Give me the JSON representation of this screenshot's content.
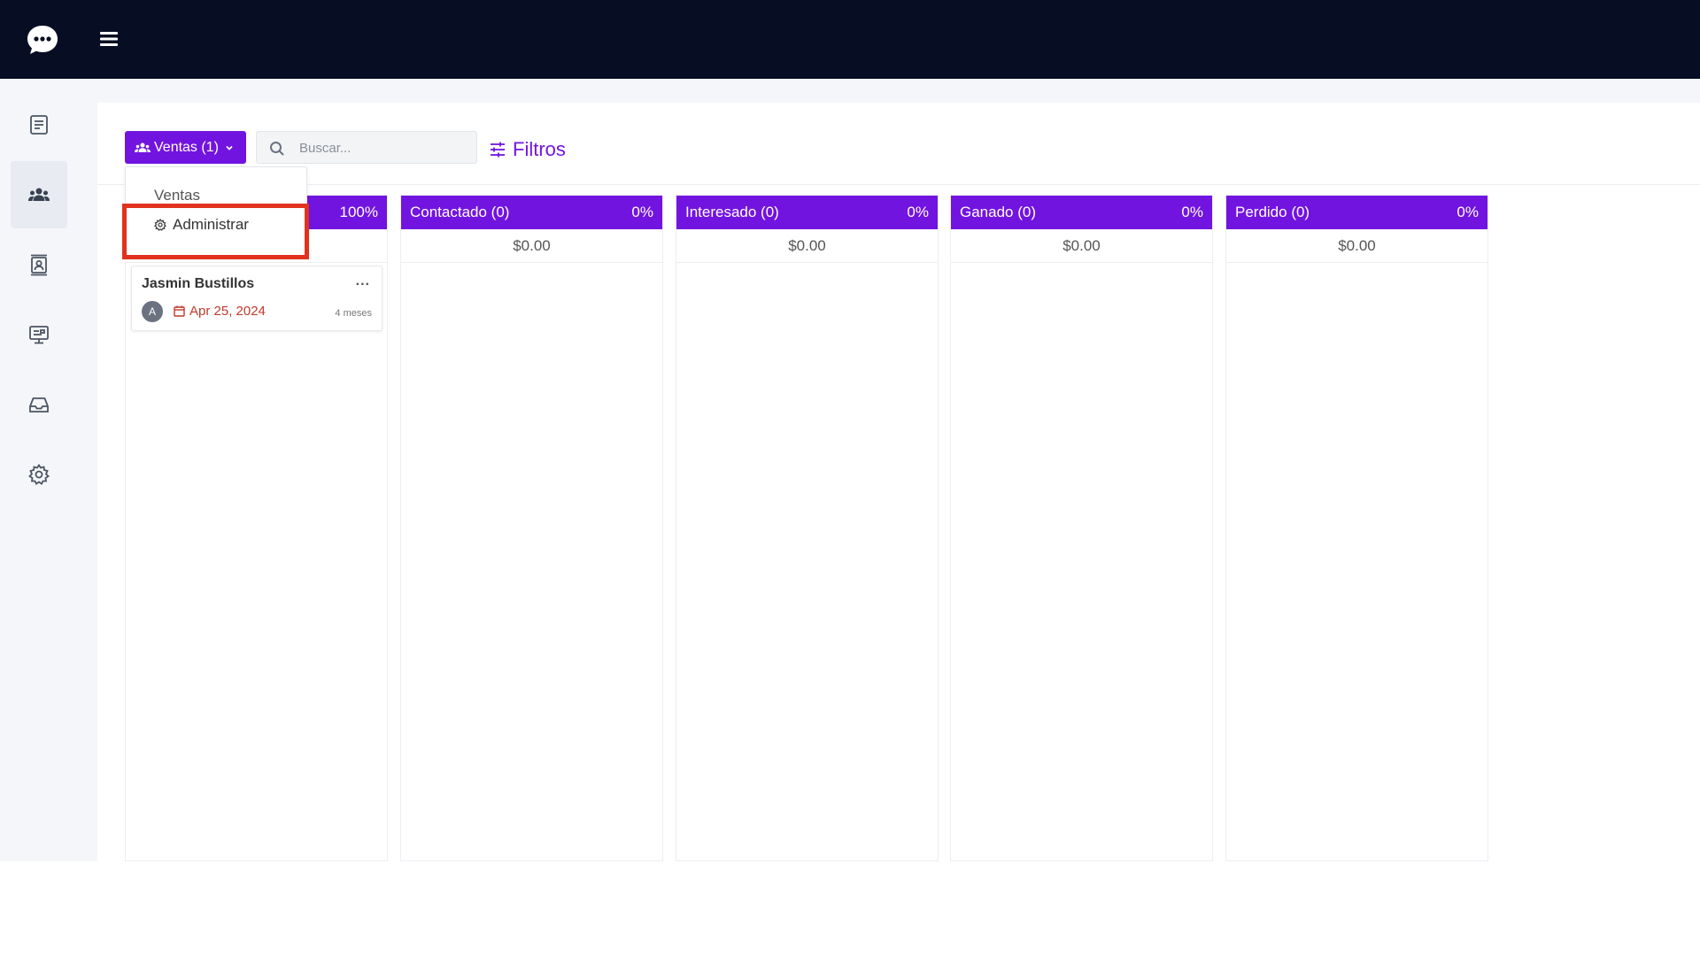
{
  "topbar": {
    "logo_icon": "chat-bubble-logo-icon",
    "menu_icon": "hamburger-icon"
  },
  "sidebar": {
    "items": [
      {
        "icon": "list-icon",
        "active": false
      },
      {
        "icon": "users-icon",
        "active": true
      },
      {
        "icon": "contact-card-icon",
        "active": false
      },
      {
        "icon": "monitor-icon",
        "active": false
      },
      {
        "icon": "inbox-icon",
        "active": false
      },
      {
        "icon": "gear-icon",
        "active": false
      }
    ]
  },
  "toolbar": {
    "pipeline_button_label": "Ventas (1)",
    "search_placeholder": "Buscar...",
    "filters_label": "Filtros"
  },
  "dropdown": {
    "items": [
      {
        "label": "Ventas"
      },
      {
        "label": "Administrar",
        "icon": "gear-icon",
        "highlighted": true
      }
    ]
  },
  "columns": [
    {
      "title": "",
      "percent": "100%",
      "amount": ""
    },
    {
      "title": "Contactado (0)",
      "percent": "0%",
      "amount": "$0.00"
    },
    {
      "title": "Interesado (0)",
      "percent": "0%",
      "amount": "$0.00"
    },
    {
      "title": "Ganado (0)",
      "percent": "0%",
      "amount": "$0.00"
    },
    {
      "title": "Perdido (0)",
      "percent": "0%",
      "amount": "$0.00"
    }
  ],
  "card": {
    "name": "Jasmin Bustillos",
    "menu": "...",
    "avatar_initial": "A",
    "date": "Apr 25, 2024",
    "age": "4 meses"
  },
  "colors": {
    "accent": "#7214e0",
    "topbar": "#070d22",
    "highlight": "#e0321d",
    "date": "#c0392b"
  }
}
